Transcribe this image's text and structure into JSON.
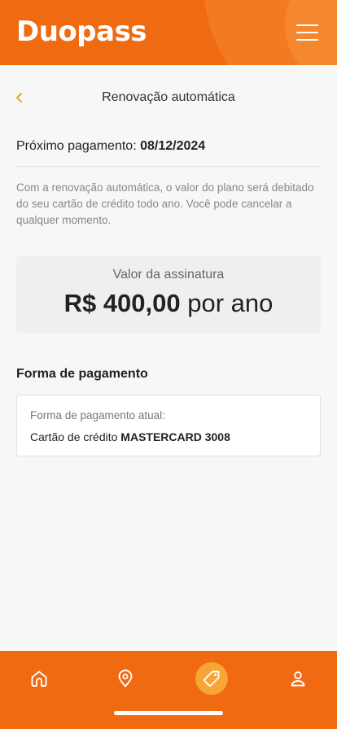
{
  "header": {
    "logo_text": "Duopass",
    "menu_icon": "hamburger-menu-icon"
  },
  "page": {
    "title": "Renovação automática",
    "back_icon": "chevron-left-icon"
  },
  "next_payment": {
    "label": "Próximo pagamento:",
    "date": "08/12/2024"
  },
  "description": "Com a renovação automática, o valor do plano será debitado do seu cartão de crédito todo ano. Você pode cancelar a qualquer momento.",
  "subscription": {
    "label": "Valor da assinatura",
    "amount": "R$ 400,00",
    "period": "por ano"
  },
  "payment_method": {
    "section_title": "Forma de pagamento",
    "current_label": "Forma de pagamento atual:",
    "card_prefix": "Cartão de crédito",
    "card_name": "MASTERCARD 3008"
  },
  "bottom_nav": {
    "items": [
      {
        "icon": "home-icon",
        "active": false
      },
      {
        "icon": "location-pin-icon",
        "active": false
      },
      {
        "icon": "tag-icon",
        "active": true
      },
      {
        "icon": "user-icon",
        "active": false
      }
    ]
  },
  "colors": {
    "brand_orange": "#f06a12",
    "accent_yellow": "#f7a535",
    "back_chevron": "#f4a430"
  }
}
